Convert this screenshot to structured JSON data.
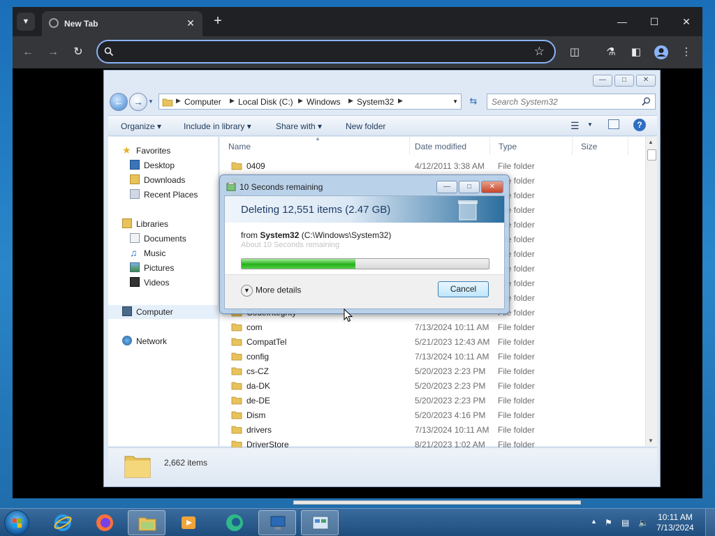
{
  "browser": {
    "tab_title": "New Tab",
    "omnibox_value": "",
    "omnibox_placeholder": ""
  },
  "explorer": {
    "breadcrumb": [
      "Computer",
      "Local Disk (C:)",
      "Windows",
      "System32"
    ],
    "search_placeholder": "Search System32",
    "commands": {
      "organize": "Organize",
      "include": "Include in library",
      "share": "Share with",
      "newfolder": "New folder"
    },
    "nav": {
      "favorites": "Favorites",
      "desktop": "Desktop",
      "downloads": "Downloads",
      "recent": "Recent Places",
      "libraries": "Libraries",
      "documents": "Documents",
      "music": "Music",
      "pictures": "Pictures",
      "videos": "Videos",
      "computer": "Computer",
      "network": "Network"
    },
    "columns": {
      "name": "Name",
      "date": "Date modified",
      "type": "Type",
      "size": "Size"
    },
    "files": [
      {
        "name": "0409",
        "date": "4/12/2011 3:38 AM",
        "type": "File folder"
      },
      {
        "name": "",
        "date": "",
        "type": "File folder"
      },
      {
        "name": "",
        "date": "",
        "type": "File folder"
      },
      {
        "name": "",
        "date": "",
        "type": "File folder"
      },
      {
        "name": "",
        "date": "",
        "type": "File folder"
      },
      {
        "name": "",
        "date": "",
        "type": "File folder"
      },
      {
        "name": "",
        "date": "",
        "type": "File folder"
      },
      {
        "name": "",
        "date": "",
        "type": "File folder"
      },
      {
        "name": "",
        "date": "",
        "type": "File folder"
      },
      {
        "name": "",
        "date": "",
        "type": "File folder"
      },
      {
        "name": "CodeIntegrity",
        "date": "",
        "type": "File folder"
      },
      {
        "name": "com",
        "date": "7/13/2024 10:11 AM",
        "type": "File folder"
      },
      {
        "name": "CompatTel",
        "date": "5/21/2023 12:43 AM",
        "type": "File folder"
      },
      {
        "name": "config",
        "date": "7/13/2024 10:11 AM",
        "type": "File folder"
      },
      {
        "name": "cs-CZ",
        "date": "5/20/2023 2:23 PM",
        "type": "File folder"
      },
      {
        "name": "da-DK",
        "date": "5/20/2023 2:23 PM",
        "type": "File folder"
      },
      {
        "name": "de-DE",
        "date": "5/20/2023 2:23 PM",
        "type": "File folder"
      },
      {
        "name": "Dism",
        "date": "5/20/2023 4:16 PM",
        "type": "File folder"
      },
      {
        "name": "drivers",
        "date": "7/13/2024 10:11 AM",
        "type": "File folder"
      },
      {
        "name": "DriverStore",
        "date": "8/21/2023 1:02 AM",
        "type": "File folder"
      }
    ],
    "status": "2,662 items"
  },
  "dialog": {
    "title": "10 Seconds remaining",
    "heading": "Deleting 12,551 items (2.47 GB)",
    "from_label": "from",
    "from_name": "System32",
    "from_path": "(C:\\Windows\\System32)",
    "ghost_text": "About 10 Seconds remaining",
    "progress_percent": 46,
    "more_details": "More details",
    "cancel": "Cancel"
  },
  "taskbar": {
    "time": "10:11 AM",
    "date": "7/13/2024"
  },
  "colors": {
    "accent": "#8ab4f8",
    "progress_green": "#26b11d"
  }
}
